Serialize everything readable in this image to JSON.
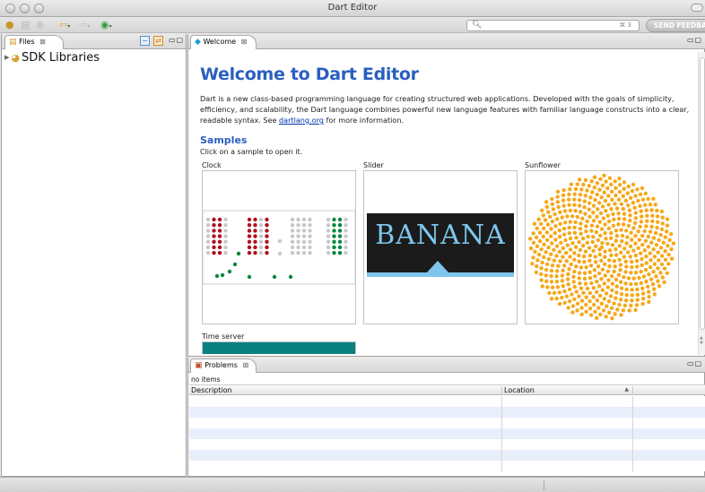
{
  "window": {
    "title": "Dart Editor"
  },
  "search": {
    "placeholder": "",
    "shortcut": "⌘ 3"
  },
  "feedback_label": "SEND FEEDBACK",
  "files_panel": {
    "tab_label": "Files",
    "tree": [
      {
        "label": "SDK Libraries"
      }
    ]
  },
  "editor": {
    "tab_label": "Welcome",
    "heading": "Welcome to Dart Editor",
    "intro_before_link": "Dart is a new class-based programming language for creating structured web applications. Developed with the goals of simplicity, efficiency, and scalability, the Dart language combines powerful new language features with familiar language constructs into a clear, readable syntax. See ",
    "intro_link": "dartlang.org",
    "intro_after_link": " for more information.",
    "samples_heading": "Samples",
    "samples_hint": "Click on a sample to open it.",
    "samples": [
      {
        "label": "Clock"
      },
      {
        "label": "Slider",
        "banner_text": "BANANA"
      },
      {
        "label": "Sunflower"
      },
      {
        "label": "Time server"
      }
    ]
  },
  "problems_panel": {
    "tab_label": "Problems",
    "status": "no items",
    "columns": [
      "Description",
      "Location"
    ],
    "rows": []
  },
  "colors": {
    "heading_blue": "#2a5fbf",
    "clock_red": "#b00f1e",
    "clock_green": "#06883d",
    "clock_gray": "#c8c8c8",
    "sunflower_orange": "#f5a81c",
    "slider_accent": "#7ec6ee",
    "timeserver_teal": "#0a8080",
    "row_stripe": "#e8eefa"
  }
}
